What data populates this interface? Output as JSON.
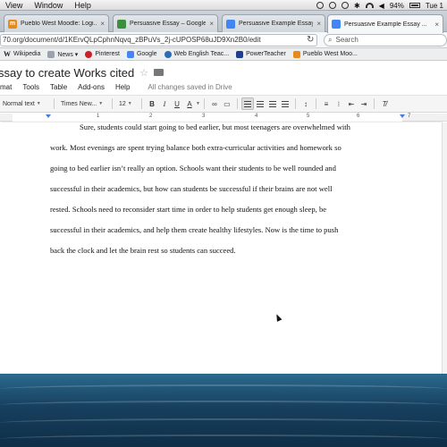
{
  "menubar": {
    "items": [
      "View",
      "Window",
      "Help"
    ],
    "battery": "94%",
    "clock": "Tue 1"
  },
  "tabs": [
    {
      "label": "Pueblo West Moodle: Logi...",
      "icon_color": "#e58a1b",
      "icon_text": "m"
    },
    {
      "label": "Persuasive Essay – Google...",
      "icon_color": "#3c8f3c",
      "icon_text": ""
    },
    {
      "label": "Persuasive Example Essay ...",
      "icon_color": "#4285f4",
      "icon_text": ""
    },
    {
      "label": "Persuasive Example Essay ...",
      "icon_color": "#4285f4",
      "icon_text": "",
      "active": true
    }
  ],
  "address": {
    "url": "70.org/document/d/1KErvQLpCphnNqvq_zBPuVs_2j-cUPOSP68uJD9Xn2B0/edit",
    "search_placeholder": "Search"
  },
  "bookmarks": [
    {
      "label": "Wikipedia",
      "icon": "wikipedia-icon",
      "color": "#444"
    },
    {
      "label": "News ▾",
      "icon": "news-icon",
      "color": "#888"
    },
    {
      "label": "Pinterest",
      "icon": "pinterest-icon",
      "color": "#cb2027"
    },
    {
      "label": "Google",
      "icon": "google-icon",
      "color": "#4285f4"
    },
    {
      "label": "Web English Teac...",
      "icon": "globe-icon",
      "color": "#2a6db5"
    },
    {
      "label": "PowerTeacher",
      "icon": "powerteacher-icon",
      "color": "#1e3f8f"
    },
    {
      "label": "Pueblo West Moo...",
      "icon": "moodle-icon",
      "color": "#e58a1b"
    }
  ],
  "doc": {
    "title": "ssay to create Works cited",
    "menu": [
      "mat",
      "Tools",
      "Table",
      "Add-ons",
      "Help"
    ],
    "saved": "All changes saved in Drive",
    "style": "Normal text",
    "font": "Times New...",
    "size": "12",
    "ruler_numbers": [
      "1",
      "2",
      "3",
      "4",
      "5",
      "6",
      "7"
    ],
    "paragraph": [
      "Sure, students could start going to bed earlier, but most teenagers are overwhelmed with",
      "work.  Most evenings are spent trying balance both extra-curricular activities and homework so",
      "going to bed earlier isn’t really an option.  Schools want their students to be well rounded and",
      "successful in their academics, but how can students be successful if their brains are not well",
      "rested.  Schools need to reconsider start time in order to help students get enough sleep, be",
      "successful in their academics, and help them create healthy lifestyles.  Now is the time to push",
      "back the clock and let the brain rest so students can succeed."
    ]
  }
}
